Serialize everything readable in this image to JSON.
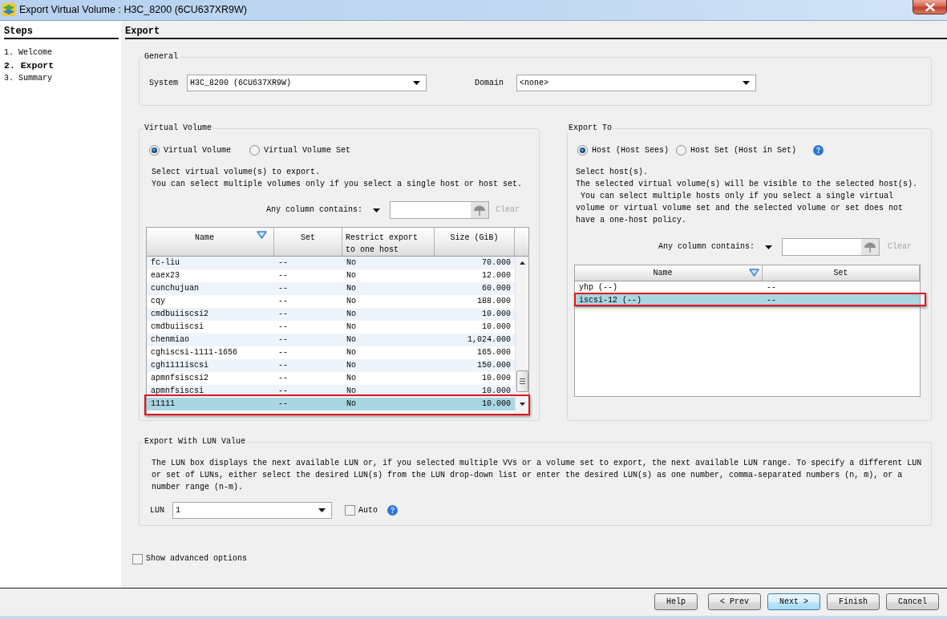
{
  "window": {
    "title": "Export Virtual Volume : H3C_8200 (6CU637XR9W)"
  },
  "steps": {
    "title": "Steps",
    "items": [
      {
        "label": "1. Welcome",
        "selected": false
      },
      {
        "label": "2. Export",
        "selected": true
      },
      {
        "label": "3. Summary",
        "selected": false
      }
    ]
  },
  "page": {
    "title": "Export"
  },
  "general": {
    "title": "General",
    "system": {
      "label": "System",
      "value": "H3C_8200 (6CU637XR9W)"
    },
    "domain": {
      "label": "Domain",
      "value": "<none>"
    }
  },
  "virtual_volume": {
    "title": "Virtual Volume",
    "modes": [
      {
        "label": "Virtual Volume",
        "selected": true
      },
      {
        "label": "Virtual Volume Set",
        "selected": false
      }
    ],
    "instructions": [
      "Select virtual volume(s) to export.",
      "You can select multiple volumes only if you select a single host or host set."
    ],
    "filter": {
      "label": "Any column contains:",
      "clear": {
        "label": "Clear",
        "disabled": true
      }
    },
    "table": {
      "columns": [
        {
          "label": "Name",
          "sorted": true
        },
        {
          "label": "Set",
          "sorted": false
        },
        {
          "label": "Restrict export to one host",
          "sorted": false
        },
        {
          "label": "Size (GiB)",
          "sorted": false
        }
      ],
      "rows": [
        {
          "cells": [
            "fc-liu",
            "--",
            "No",
            "70.000"
          ],
          "selected": false,
          "highlighted": false
        },
        {
          "cells": [
            "eaex23",
            "--",
            "No",
            "12.000"
          ],
          "selected": false,
          "highlighted": false
        },
        {
          "cells": [
            "cunchujuan",
            "--",
            "No",
            "60.000"
          ],
          "selected": false,
          "highlighted": false
        },
        {
          "cells": [
            "cqy",
            "--",
            "No",
            "188.000"
          ],
          "selected": false,
          "highlighted": false
        },
        {
          "cells": [
            "cmdbuiiscsi2",
            "--",
            "No",
            "10.000"
          ],
          "selected": false,
          "highlighted": false
        },
        {
          "cells": [
            "cmdbuiiscsi",
            "--",
            "No",
            "10.000"
          ],
          "selected": false,
          "highlighted": false
        },
        {
          "cells": [
            "chenmiao",
            "--",
            "No",
            "1,024.000"
          ],
          "selected": false,
          "highlighted": false
        },
        {
          "cells": [
            "cghiscsi-1111-1656",
            "--",
            "No",
            "165.000"
          ],
          "selected": false,
          "highlighted": false
        },
        {
          "cells": [
            "cgh1111iscsi",
            "--",
            "No",
            "150.000"
          ],
          "selected": false,
          "highlighted": false
        },
        {
          "cells": [
            "apmnfsiscsi2",
            "--",
            "No",
            "10.000"
          ],
          "selected": false,
          "highlighted": false
        },
        {
          "cells": [
            "apmnfsiscsi",
            "--",
            "No",
            "10.000"
          ],
          "selected": false,
          "highlighted": false
        },
        {
          "cells": [
            "11111",
            "--",
            "No",
            "10.000"
          ],
          "selected": true,
          "highlighted": true
        }
      ]
    }
  },
  "export_to": {
    "title": "Export To",
    "modes": [
      {
        "label": "Host (Host Sees)",
        "selected": true
      },
      {
        "label": "Host Set (Host in Set)",
        "selected": false
      }
    ],
    "instructions": [
      "Select host(s).",
      "The selected virtual volume(s) will be visible to the selected host(s).",
      " You can select multiple hosts only if you select a single virtual volume or virtual volume set and the selected volume or set does not have a one-host policy."
    ],
    "filter": {
      "label": "Any column contains:",
      "clear": {
        "label": "Clear",
        "disabled": true
      }
    },
    "table": {
      "columns": [
        {
          "label": "Name",
          "sorted": true
        },
        {
          "label": "Set",
          "sorted": false
        }
      ],
      "rows": [
        {
          "cells": [
            "yhp (--)",
            "--"
          ],
          "selected": false,
          "highlighted": false
        },
        {
          "cells": [
            "iscsi-12 (--)",
            "--"
          ],
          "selected": true,
          "highlighted": true
        }
      ]
    }
  },
  "lun": {
    "title": "Export With LUN Value",
    "description": "The LUN box displays the next available LUN or, if you selected multiple VVs or a volume set to export, the next available LUN range. To specify a different LUN or set of LUNs, either select the desired LUN(s) from the LUN drop-down list or enter the desired LUN(s) as one number, comma-separated numbers (n, m), or a number range (n-m).",
    "label": "LUN",
    "value": "1",
    "auto": {
      "label": "Auto",
      "checked": false
    }
  },
  "advanced": {
    "label": "Show advanced options",
    "checked": false
  },
  "buttons": [
    {
      "label": "Help",
      "focused": false
    },
    {
      "label": "< Prev",
      "focused": false
    },
    {
      "label": "Next >",
      "focused": true
    },
    {
      "label": "Finish",
      "focused": false
    },
    {
      "label": "Cancel",
      "focused": false
    }
  ]
}
